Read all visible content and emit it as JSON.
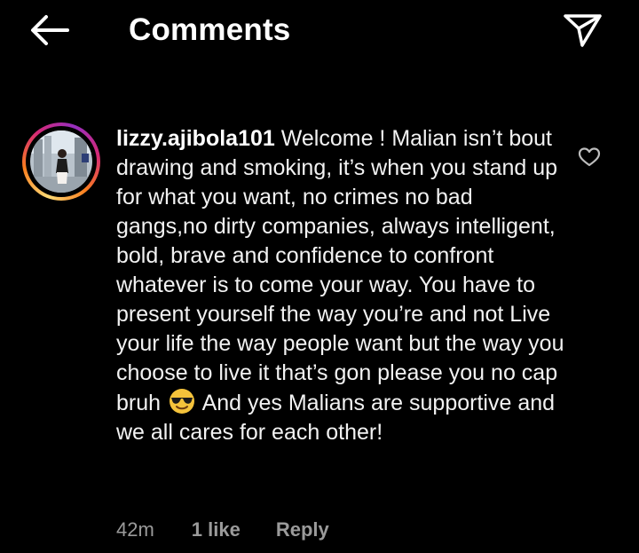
{
  "header": {
    "title": "Comments",
    "back_icon": "arrow-left-icon",
    "send_icon": "paper-plane-icon"
  },
  "comment": {
    "username": "lizzy.ajibola101",
    "text_before_emoji": "Welcome ! Malian isn’t bout drawing and smoking, it’s when you stand up for what you want, no crimes no bad gangs,no dirty companies, always intelligent, bold, brave and confidence to confront whatever is to come your way. You have to present yourself the way you’re and not Live  your life the way people want but the way you choose to live it that’s gon please you no cap bruh",
    "emoji": "😎",
    "text_after_emoji": "And yes Malians are supportive and we all cares for each other!",
    "time": "42m",
    "likes": "1 like",
    "reply_label": "Reply",
    "heart_icon": "heart-outline-icon",
    "avatar_ring_colors": [
      "#feda75",
      "#fa7e1e",
      "#d62976",
      "#962fbf"
    ]
  },
  "colors": {
    "background": "#000000",
    "text": "#ffffff",
    "meta_text": "#9a9a9a"
  }
}
